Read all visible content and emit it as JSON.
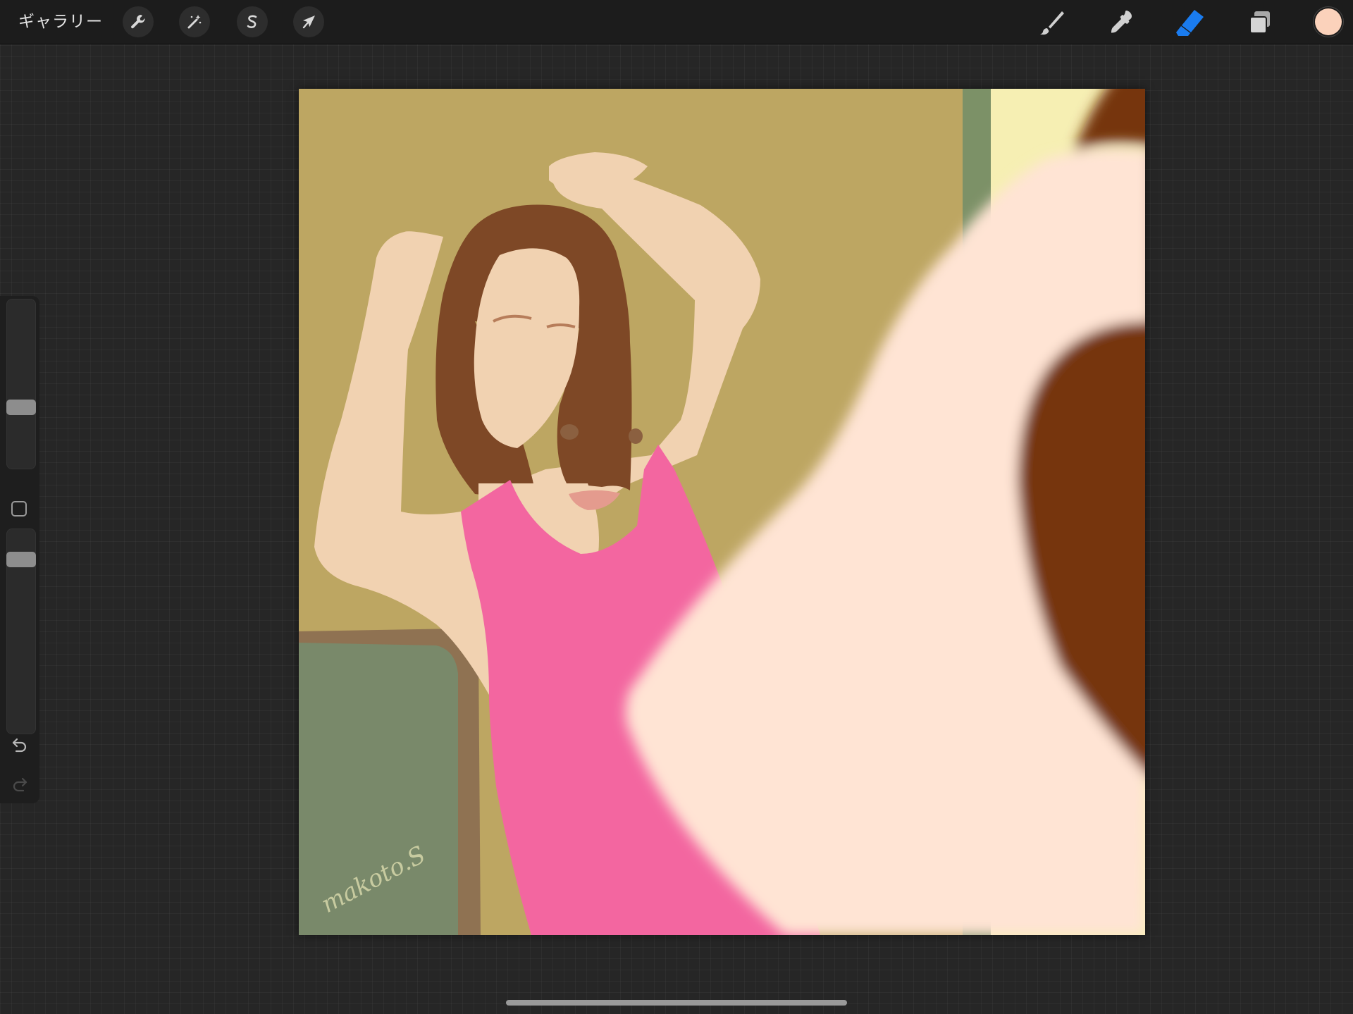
{
  "toolbar": {
    "gallery_label": "ギャラリー",
    "left_tools": [
      {
        "id": "actions",
        "icon": "wrench-icon"
      },
      {
        "id": "adjustments",
        "icon": "magic-wand-icon"
      },
      {
        "id": "selection",
        "icon": "selection-s-icon"
      },
      {
        "id": "transform",
        "icon": "arrow-cursor-icon"
      }
    ],
    "right_tools": [
      {
        "id": "brush",
        "icon": "brush-icon",
        "active": false
      },
      {
        "id": "smudge",
        "icon": "smudge-icon",
        "active": false
      },
      {
        "id": "eraser",
        "icon": "eraser-icon",
        "active": true
      },
      {
        "id": "layers",
        "icon": "layers-icon",
        "active": false
      }
    ],
    "current_color": "#fbd2bb",
    "accent_color": "#1a7cf0"
  },
  "sidebar": {
    "brush_size_level": 0.35,
    "opacity_level": 0.88,
    "undo_icon": "undo-icon",
    "redo_icon": "redo-icon"
  },
  "artwork": {
    "signature": "makoto.S",
    "colors": {
      "wall": "#bda662",
      "door_green": "#7c9167",
      "light": "#f6efb3",
      "hair": "#7e4826",
      "skin": "#f1d2b1",
      "dress": "#f366a0",
      "chair": "#79896a",
      "chair_frame": "#8f7252",
      "foreground_arm": "#ffe4d4",
      "foreground_hair": "#76340f"
    }
  }
}
